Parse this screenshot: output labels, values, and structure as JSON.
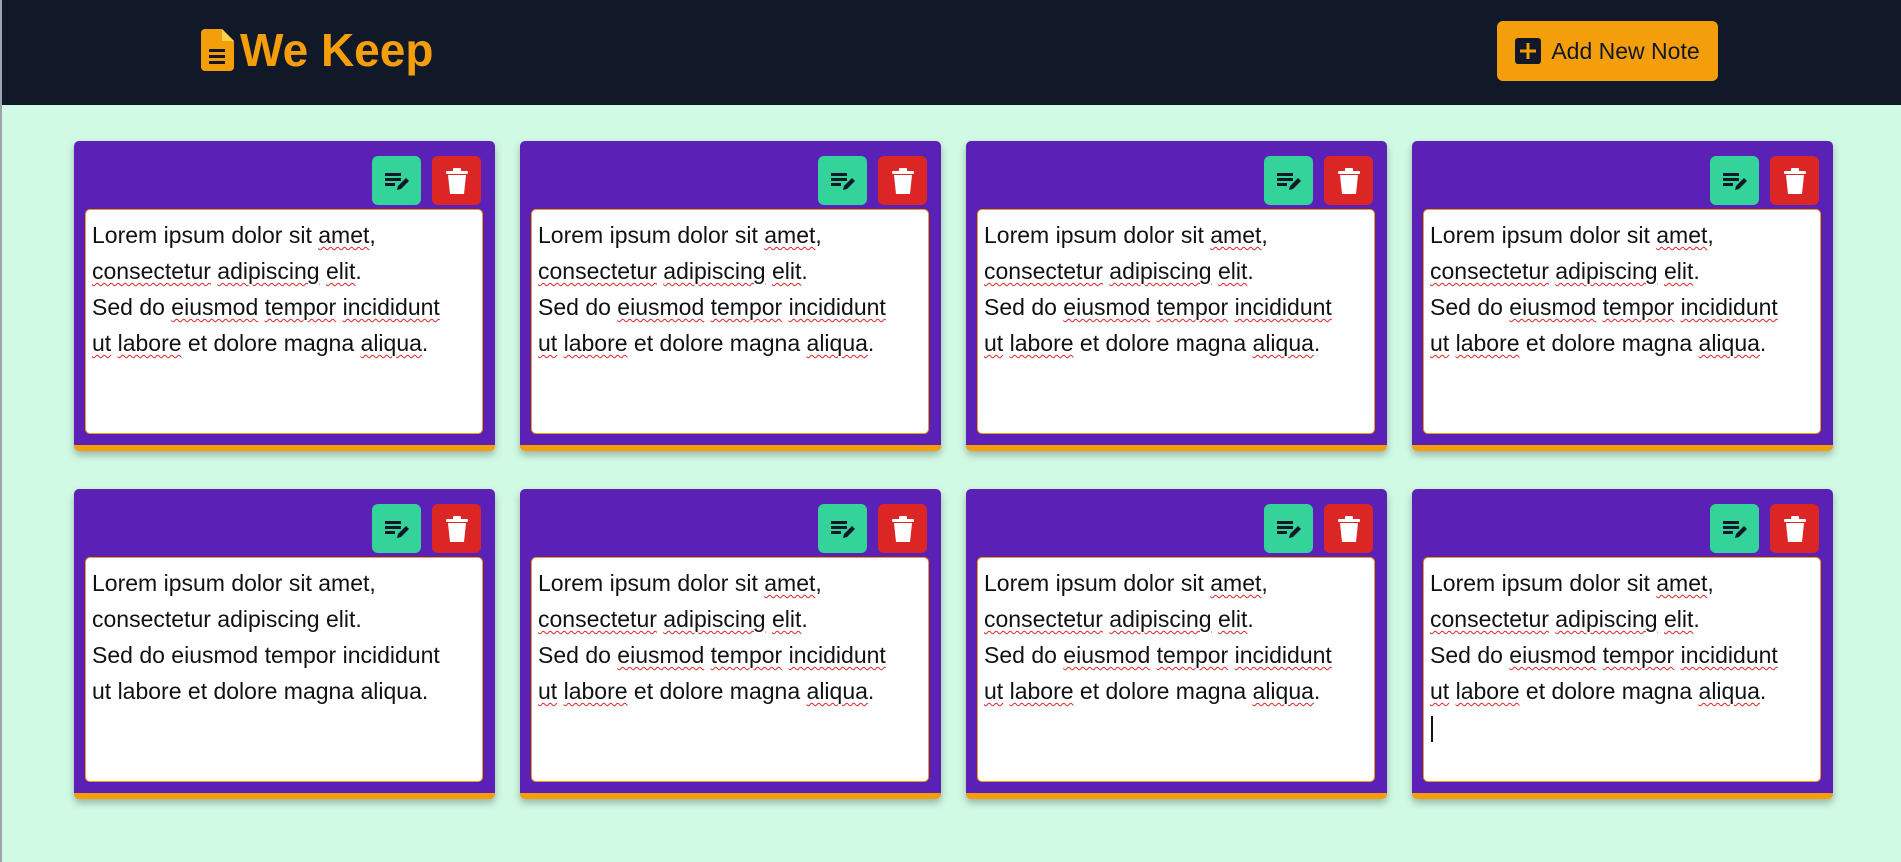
{
  "app": {
    "title": "We Keep",
    "add_button_label": "Add New Note"
  },
  "colors": {
    "navbar_bg": "#111827",
    "page_bg": "#d1fae5",
    "accent": "#f59e0b",
    "card_bg": "#5b21b6",
    "edit_button": "#34d399",
    "delete_button": "#dc2626"
  },
  "icons": {
    "brand": "file-text-icon",
    "add": "plus-square-icon",
    "edit": "edit-note-icon",
    "delete": "trash-icon"
  },
  "notes": [
    {
      "lines": [
        "Lorem ipsum dolor sit amet,",
        "consectetur adipiscing elit.",
        "Sed do eiusmod tempor incididunt",
        "ut labore et dolore magna aliqua."
      ],
      "spellcheck_marked": true,
      "has_caret": false
    },
    {
      "lines": [
        "Lorem ipsum dolor sit amet,",
        "consectetur adipiscing elit.",
        "Sed do eiusmod tempor incididunt",
        "ut labore et dolore magna aliqua."
      ],
      "spellcheck_marked": true,
      "has_caret": false
    },
    {
      "lines": [
        "Lorem ipsum dolor sit amet,",
        "consectetur adipiscing elit.",
        "Sed do eiusmod tempor incididunt",
        "ut labore et dolore magna aliqua."
      ],
      "spellcheck_marked": true,
      "has_caret": false
    },
    {
      "lines": [
        "Lorem ipsum dolor sit amet,",
        "consectetur adipiscing elit.",
        "Sed do eiusmod tempor incididunt",
        "ut labore et dolore magna aliqua."
      ],
      "spellcheck_marked": true,
      "has_caret": false
    },
    {
      "lines": [
        "Lorem ipsum dolor sit amet,",
        "consectetur adipiscing elit.",
        "Sed do eiusmod tempor incididunt",
        "ut labore et dolore magna aliqua."
      ],
      "spellcheck_marked": false,
      "has_caret": false
    },
    {
      "lines": [
        "Lorem ipsum dolor sit amet,",
        "consectetur adipiscing elit.",
        "Sed do eiusmod tempor incididunt",
        "ut labore et dolore magna aliqua."
      ],
      "spellcheck_marked": true,
      "has_caret": false
    },
    {
      "lines": [
        "Lorem ipsum dolor sit amet,",
        "consectetur adipiscing elit.",
        "Sed do eiusmod tempor incididunt",
        "ut labore et dolore magna aliqua."
      ],
      "spellcheck_marked": true,
      "has_caret": false
    },
    {
      "lines": [
        "Lorem ipsum dolor sit amet,",
        "consectetur adipiscing elit.",
        "Sed do eiusmod tempor incididunt",
        "ut labore et dolore magna aliqua."
      ],
      "spellcheck_marked": true,
      "has_caret": true
    }
  ]
}
